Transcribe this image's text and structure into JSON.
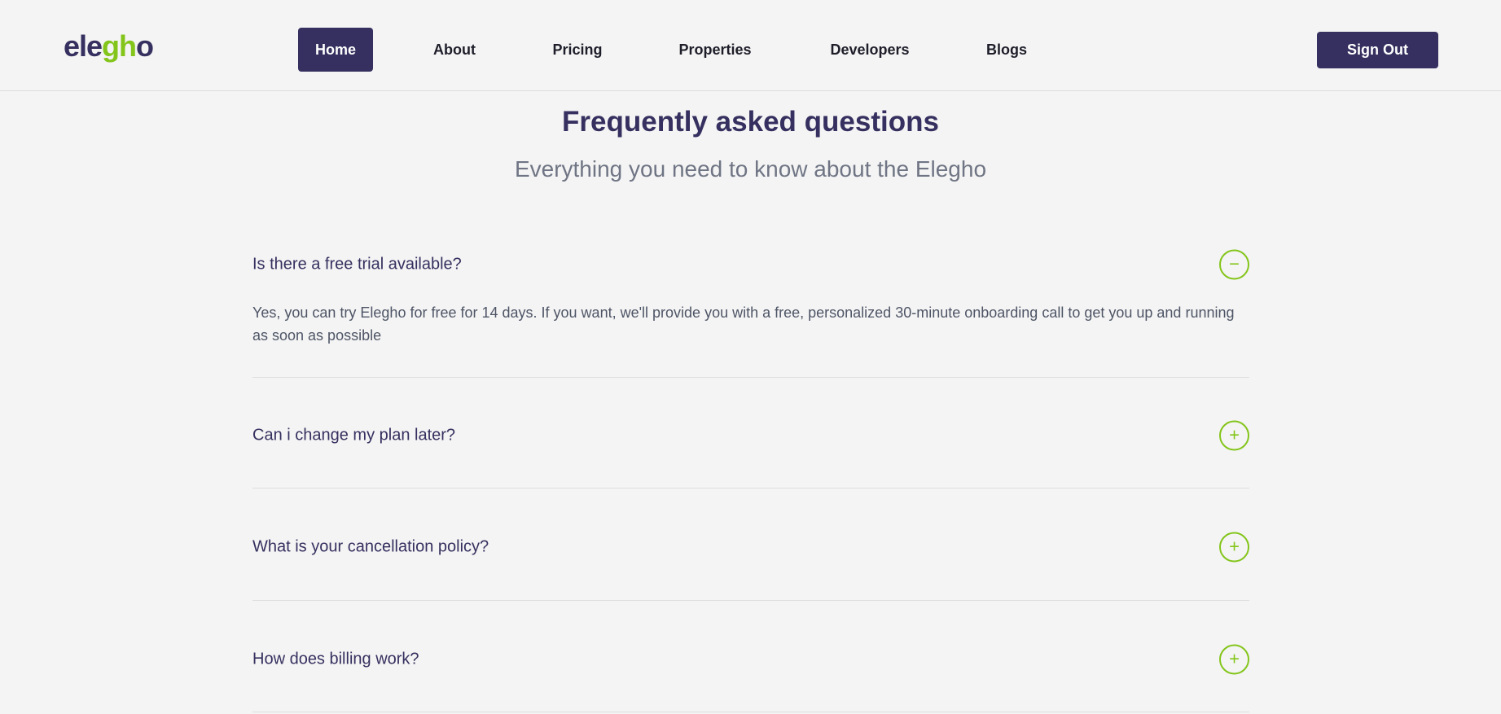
{
  "header": {
    "logo": {
      "part1": "ele",
      "part2": "gh",
      "part3": "o"
    },
    "nav": [
      "Home",
      "About",
      "Pricing",
      "Properties",
      "Developers",
      "Blogs"
    ],
    "active": "Home",
    "sign_out": "Sign Out"
  },
  "title": "Frequently asked questions",
  "subtitle": "Everything you need to know about the Elegho",
  "faq": [
    {
      "q": "Is there a free trial available?",
      "a": "Yes, you can try Elegho for free for 14 days. If you want, we'll provide you with a free, personalized 30-minute onboarding call to get you up and running as soon as possible",
      "icon": "−",
      "expanded": true
    },
    {
      "q": "Can i change my plan later?",
      "icon": "+",
      "expanded": false
    },
    {
      "q": "What is your cancellation policy?",
      "icon": "+",
      "expanded": false
    },
    {
      "q": "How does billing work?",
      "icon": "+",
      "expanded": false
    }
  ],
  "colors": {
    "brand": "#35305f",
    "accent": "#84c51b"
  }
}
